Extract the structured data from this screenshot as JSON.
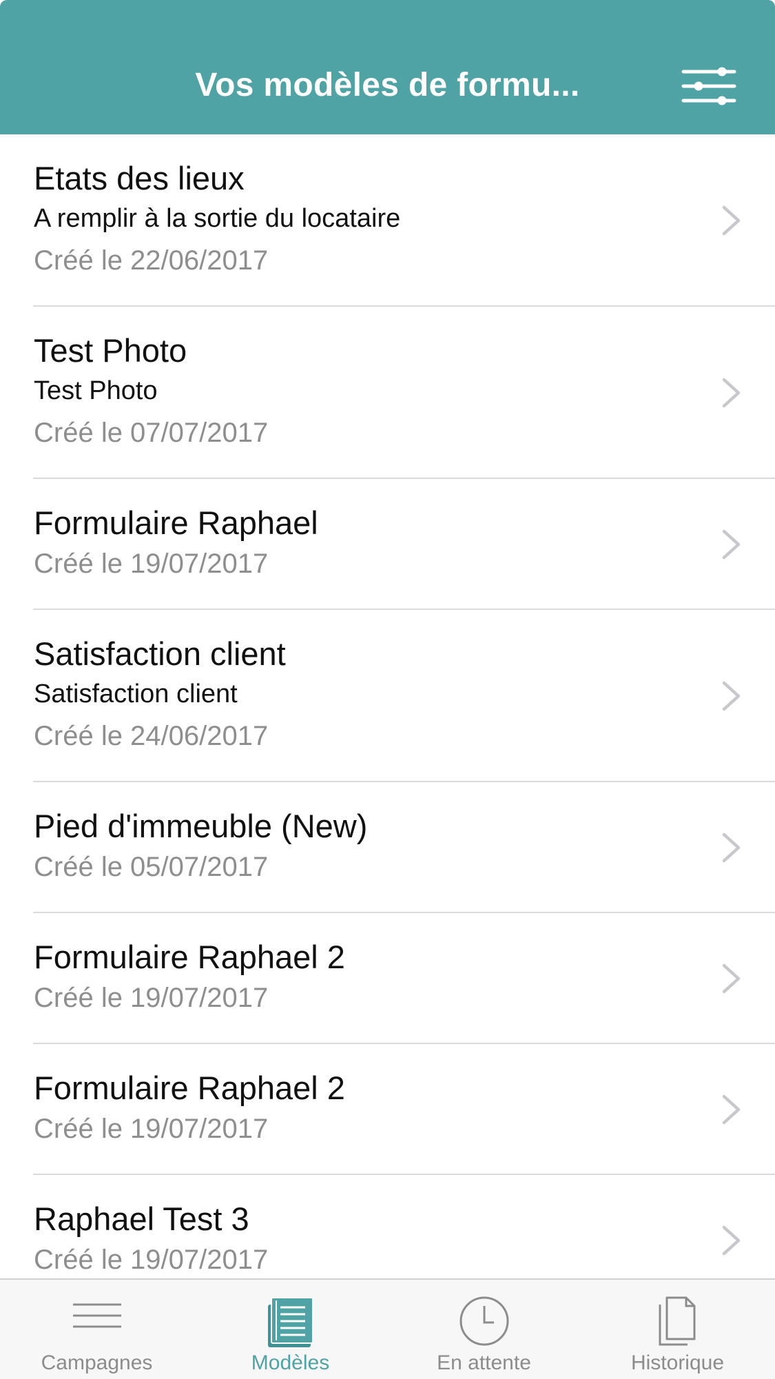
{
  "colors": {
    "header_background": "#4fa3a5",
    "accent": "#4fa3a5",
    "text_primary": "#111111",
    "text_secondary": "#8e8e8e",
    "tab_inactive": "#8c8c8c",
    "separator": "#d9d9d9"
  },
  "header": {
    "title": "Vos modèles de formu...",
    "filter_icon": "sliders-icon"
  },
  "forms": [
    {
      "title": "Etats des lieux",
      "subtitle": "A remplir à la sortie du locataire",
      "date": "Créé le 22/06/2017"
    },
    {
      "title": "Test Photo",
      "subtitle": "Test Photo",
      "date": "Créé le 07/07/2017"
    },
    {
      "title": "Formulaire Raphael",
      "subtitle": "",
      "date": "Créé le 19/07/2017"
    },
    {
      "title": "Satisfaction client",
      "subtitle": "Satisfaction client",
      "date": "Créé le 24/06/2017"
    },
    {
      "title": "Pied d'immeuble (New)",
      "subtitle": "",
      "date": "Créé le 05/07/2017"
    },
    {
      "title": "Formulaire Raphael 2",
      "subtitle": "",
      "date": "Créé le 19/07/2017"
    },
    {
      "title": "Formulaire Raphael 2",
      "subtitle": "",
      "date": "Créé le 19/07/2017"
    },
    {
      "title": "Raphael Test 3",
      "subtitle": "",
      "date": "Créé le 19/07/2017"
    }
  ],
  "tabs": [
    {
      "label": "Campagnes",
      "icon": "lines-icon",
      "active": false
    },
    {
      "label": "Modèles",
      "icon": "document-list-icon",
      "active": true
    },
    {
      "label": "En attente",
      "icon": "clock-icon",
      "active": false
    },
    {
      "label": "Historique",
      "icon": "documents-icon",
      "active": false
    }
  ]
}
